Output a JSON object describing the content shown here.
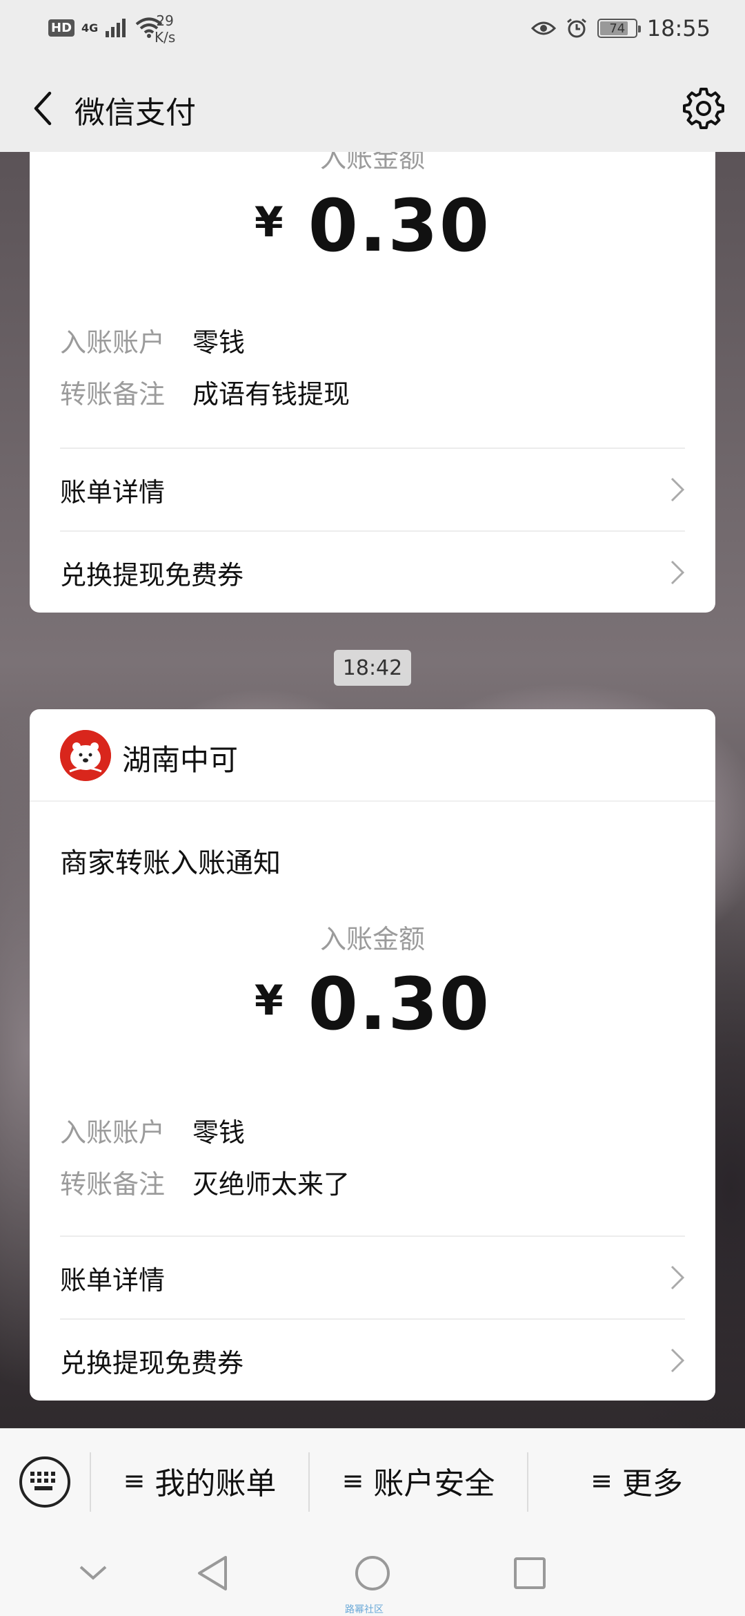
{
  "status_bar": {
    "hd": "HD",
    "network": "4G",
    "speed_value": "29",
    "speed_unit": "K/s",
    "battery": "74",
    "battery_level_pct": 74,
    "time": "18:55"
  },
  "title_bar": {
    "title": "微信支付",
    "back_icon": "chevron-left-icon",
    "settings_icon": "gear-icon"
  },
  "card1": {
    "amount_label": "入账金额",
    "currency": "¥",
    "amount": "0.30",
    "account_key": "入账账户",
    "account_value": "零钱",
    "remark_key": "转账备注",
    "remark_value": "成语有钱提现",
    "link1": "账单详情",
    "link2": "兑换提现免费券"
  },
  "time_chip": "18:42",
  "card2": {
    "merchant": "湖南中可",
    "notify_title": "商家转账入账通知",
    "amount_label": "入账金额",
    "currency": "¥",
    "amount": "0.30",
    "account_key": "入账账户",
    "account_value": "零钱",
    "remark_key": "转账备注",
    "remark_value": "灭绝师太来了",
    "link1": "账单详情",
    "link2": "兑换提现免费券"
  },
  "bottom_menu": {
    "keyboard_icon": "keyboard-icon",
    "items": [
      "我的账单",
      "账户安全",
      "更多"
    ],
    "menu_glyph": "≡"
  },
  "nav_bar": {
    "watermark": "路幂社区"
  },
  "colors": {
    "accent_text": "#111111",
    "muted_text": "#9b9b9b",
    "bar_bg": "#ededed",
    "logo_red": "#d9261c"
  }
}
